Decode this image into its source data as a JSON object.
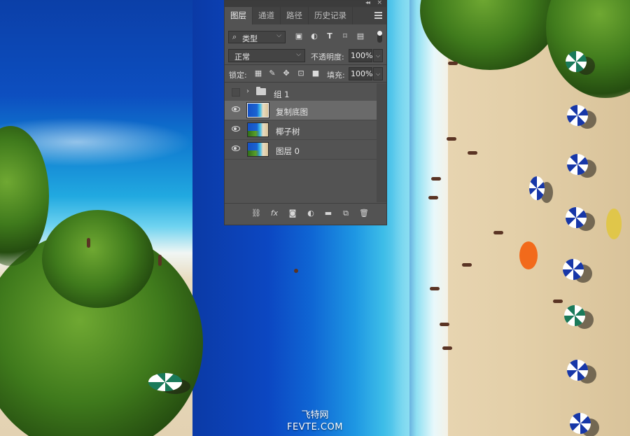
{
  "panel": {
    "tabs": [
      {
        "label": "图层",
        "active": true
      },
      {
        "label": "通道",
        "active": false
      },
      {
        "label": "路径",
        "active": false
      },
      {
        "label": "历史记录",
        "active": false
      }
    ],
    "filter": {
      "kind_label": "类型",
      "icons": [
        "image-filter-icon",
        "adjustment-filter-icon",
        "type-filter-icon",
        "shape-filter-icon",
        "smart-object-filter-icon"
      ]
    },
    "blend_mode": "正常",
    "opacity_label": "不透明度:",
    "opacity_value": "100%",
    "lock_label": "锁定:",
    "fill_label": "填充:",
    "fill_value": "100%",
    "layers": [
      {
        "name": "组 1",
        "type": "group",
        "visible": false,
        "selected": false
      },
      {
        "name": "复制底图",
        "type": "image",
        "visible": true,
        "selected": true
      },
      {
        "name": "椰子树",
        "type": "image",
        "visible": true,
        "selected": false
      },
      {
        "name": "图层 0",
        "type": "image",
        "visible": true,
        "selected": false
      }
    ],
    "bottom_icons": [
      "link-layers-icon",
      "fx-icon",
      "add-mask-icon",
      "new-adjustment-layer-icon",
      "new-group-icon",
      "new-layer-icon",
      "delete-layer-icon"
    ]
  },
  "watermark": {
    "line1": "飞特网",
    "line2": "FEVTE.COM"
  },
  "colors": {
    "panel_bg": "#535353",
    "tab_bar": "#424242",
    "selected_layer": "#6a6a6a"
  }
}
